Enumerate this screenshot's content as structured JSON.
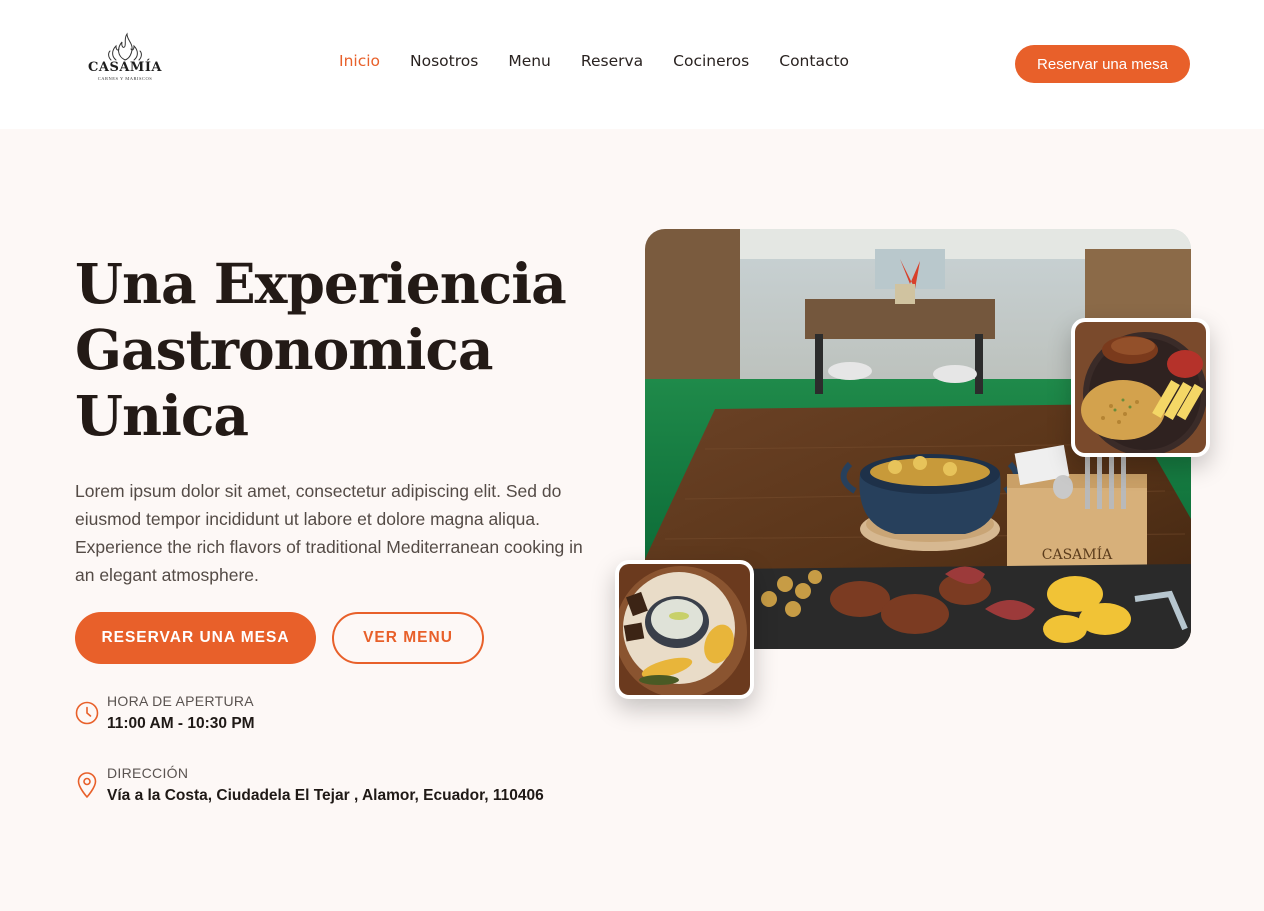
{
  "brand": {
    "name": "CASAMÍA",
    "tagline": "CARNES Y MARISCOS"
  },
  "nav": {
    "items": [
      {
        "label": "Inicio",
        "active": true
      },
      {
        "label": "Nosotros",
        "active": false
      },
      {
        "label": "Menu",
        "active": false
      },
      {
        "label": "Reserva",
        "active": false
      },
      {
        "label": "Cocineros",
        "active": false
      },
      {
        "label": "Contacto",
        "active": false
      }
    ],
    "cta_label": "Reservar una mesa"
  },
  "hero": {
    "title_lines": [
      "Una Experiencia",
      "Gastronomica",
      "Unica"
    ],
    "description": "Lorem ipsum dolor sit amet, consectetur adipiscing elit. Sed do eiusmod tempor incididunt ut labore et dolore magna aliqua. Experience the rich flavors of traditional Mediterranean cooking in an elegant atmosphere.",
    "primary_button": "RESERVAR UNA MESA",
    "secondary_button": "VER MENU"
  },
  "info": {
    "hours": {
      "label": "HORA DE APERTURA",
      "value": "11:00 AM - 10:30 PM",
      "icon": "clock-icon"
    },
    "address": {
      "label": "DIRECCIÓN",
      "value": "Vía a la Costa, Ciudadela El Tejar , Alamor, Ecuador, 110406",
      "icon": "location-pin-icon"
    }
  },
  "colors": {
    "accent": "#e8602a",
    "background": "#fdf8f6",
    "header_bg": "#ffffff",
    "title": "#231a16"
  }
}
